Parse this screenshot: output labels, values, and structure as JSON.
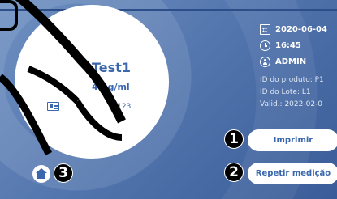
{
  "sample": {
    "name": "Test1",
    "concentration": "4 µg/ml",
    "code": "X123",
    "icon": "id-card-icon"
  },
  "info": {
    "date": "2020-06-04",
    "time": "16:45",
    "user": "ADMIN",
    "product_id": "ID do produto: P1",
    "lot_id": "ID do Lote: L1",
    "valid": "Valid.: 2022-02-0",
    "icons": [
      "calendar-icon",
      "clock-icon",
      "user-icon"
    ]
  },
  "buttons": {
    "print_label": "Imprimir",
    "repeat_label": "Repetir medição",
    "home_icon": "home-icon"
  },
  "callouts": [
    "1",
    "2",
    "3"
  ],
  "colors": {
    "background": "#4f72ab",
    "accent_text": "#3a67ad",
    "button_bg": "#ffffff",
    "callout_bg": "#000000"
  }
}
